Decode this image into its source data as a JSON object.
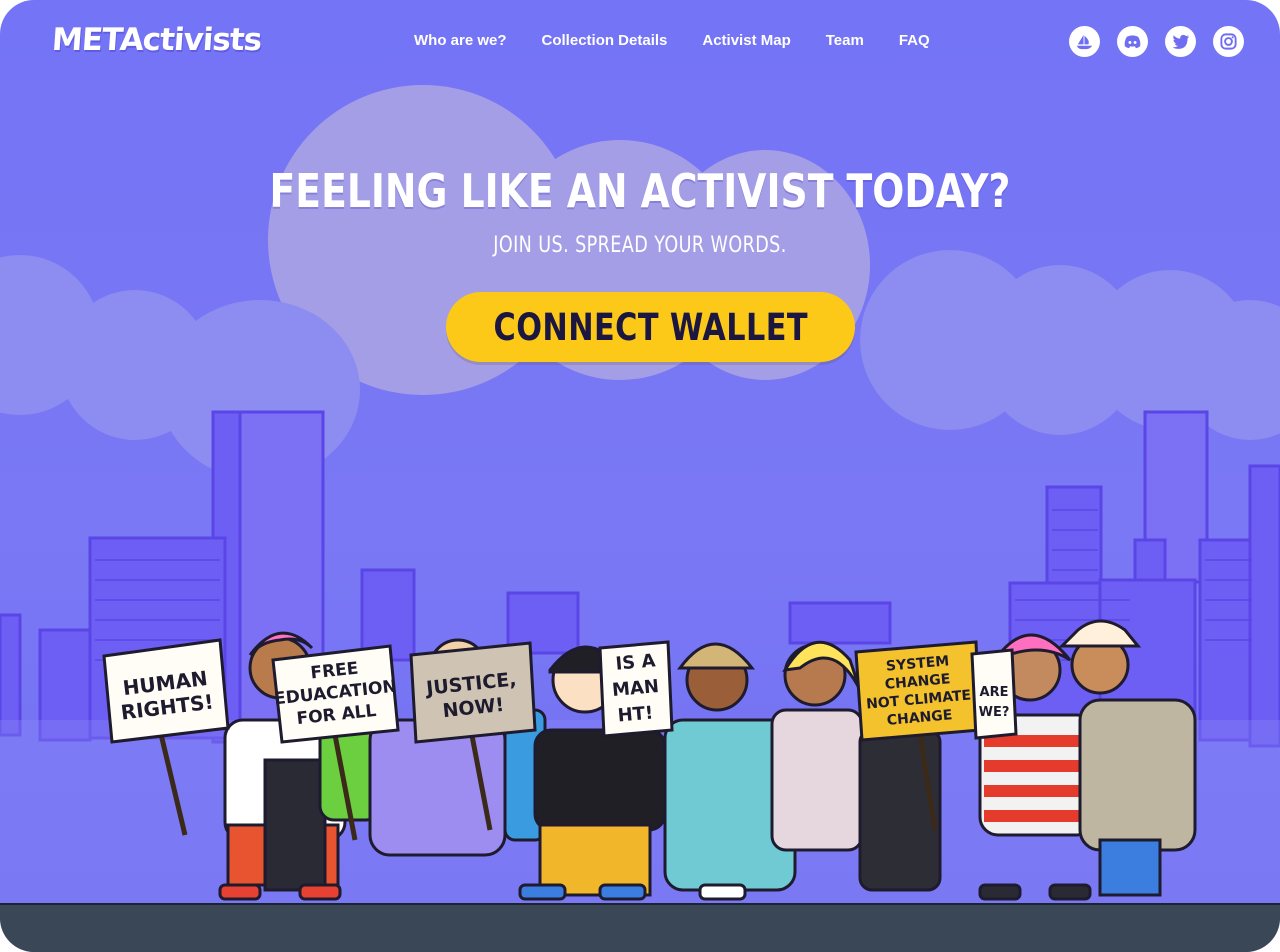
{
  "brand": {
    "logo_text": "METActivists"
  },
  "nav": {
    "items": [
      "Who are we?",
      "Collection Details",
      "Activist Map",
      "Team",
      "FAQ"
    ]
  },
  "socials": [
    {
      "name": "opensea-icon"
    },
    {
      "name": "discord-icon"
    },
    {
      "name": "twitter-icon"
    },
    {
      "name": "instagram-icon"
    }
  ],
  "hero": {
    "title": "FEELING LIKE AN ACTIVIST TODAY?",
    "subtitle": "JOIN US. SPREAD YOUR WORDS.",
    "cta_label": "CONNECT WALLET"
  },
  "signs": [
    {
      "text": "HUMAN RIGHTS!"
    },
    {
      "text": "FREE EDUACATION FOR ALL"
    },
    {
      "text": "JUSTICE, NOW!"
    },
    {
      "text": "IS A MAN HT!"
    },
    {
      "text": "SYSTEM CHANGE NOT CLIMATE CHANGE"
    },
    {
      "text": "ARE WE?"
    }
  ],
  "colors": {
    "background": "#7474f6",
    "cta": "#fcc919",
    "cta_text": "#1c1740",
    "ground": "#3a4757",
    "buildings": "#6b5cf4"
  }
}
